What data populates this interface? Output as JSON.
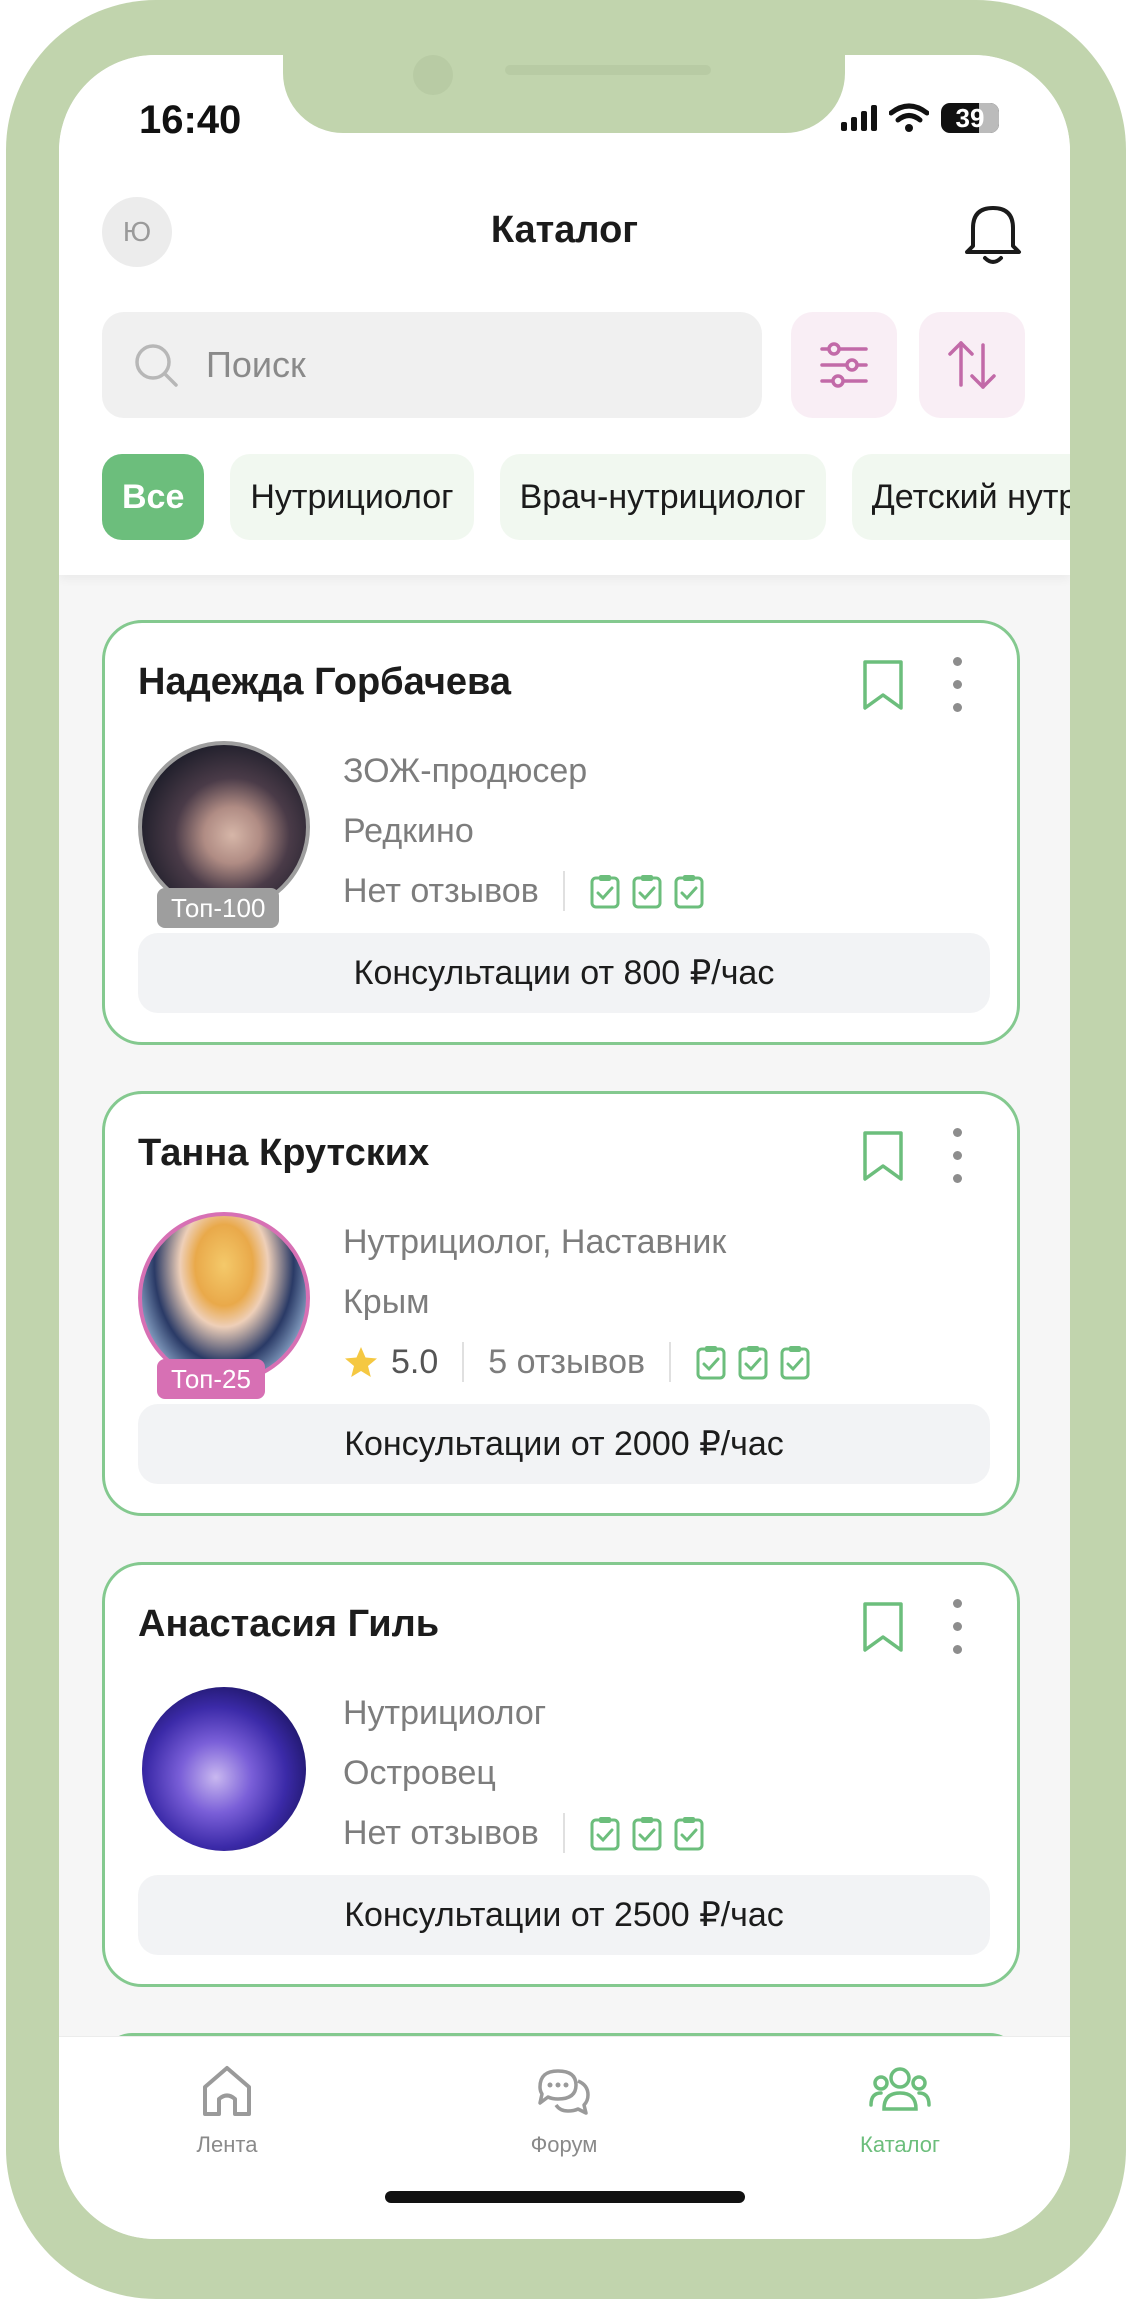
{
  "status_bar": {
    "time": "16:40",
    "battery": "39"
  },
  "header": {
    "user_initial": "Ю",
    "title": "Каталог"
  },
  "search": {
    "placeholder": "Поиск"
  },
  "filters": [
    "Все",
    "Нутрициолог",
    "Врач-нутрициолог",
    "Детский нутрициолог"
  ],
  "cards": [
    {
      "name": "Надежда Горбачева",
      "role": "ЗОЖ-продюсер",
      "city": "Редкино",
      "reviews": "Нет отзывов",
      "badge": "Топ-100",
      "badge_color": "#9e9e9e",
      "price": "Консультации от 800 ₽/час"
    },
    {
      "name": "Танна Крутских",
      "role": "Нутрициолог, Наставник",
      "city": "Крым",
      "rating": "5.0",
      "reviews": "5 отзывов",
      "badge": "Топ-25",
      "badge_color": "#d770b4",
      "price": "Консультации от 2000 ₽/час"
    },
    {
      "name": "Анастасия Гиль",
      "role": "Нутрициолог",
      "city": "Островец",
      "reviews": "Нет отзывов",
      "price": "Консультации от 2500 ₽/час"
    }
  ],
  "tabbar": {
    "feed": "Лента",
    "forum": "Форум",
    "catalog": "Каталог"
  },
  "colors": {
    "accent_green": "#6cbe7c",
    "accent_pink": "#c26aa8",
    "frame": "#c1d4ad"
  }
}
